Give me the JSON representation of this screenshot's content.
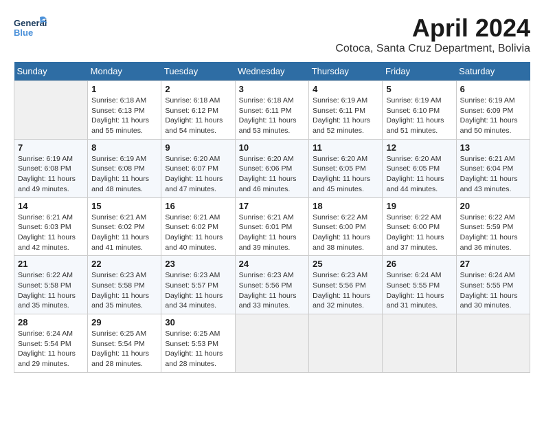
{
  "header": {
    "logo_general": "General",
    "logo_blue": "Blue",
    "month": "April 2024",
    "location": "Cotoca, Santa Cruz Department, Bolivia"
  },
  "days_of_week": [
    "Sunday",
    "Monday",
    "Tuesday",
    "Wednesday",
    "Thursday",
    "Friday",
    "Saturday"
  ],
  "weeks": [
    [
      {
        "day": "",
        "info": ""
      },
      {
        "day": "1",
        "info": "Sunrise: 6:18 AM\nSunset: 6:13 PM\nDaylight: 11 hours\nand 55 minutes."
      },
      {
        "day": "2",
        "info": "Sunrise: 6:18 AM\nSunset: 6:12 PM\nDaylight: 11 hours\nand 54 minutes."
      },
      {
        "day": "3",
        "info": "Sunrise: 6:18 AM\nSunset: 6:11 PM\nDaylight: 11 hours\nand 53 minutes."
      },
      {
        "day": "4",
        "info": "Sunrise: 6:19 AM\nSunset: 6:11 PM\nDaylight: 11 hours\nand 52 minutes."
      },
      {
        "day": "5",
        "info": "Sunrise: 6:19 AM\nSunset: 6:10 PM\nDaylight: 11 hours\nand 51 minutes."
      },
      {
        "day": "6",
        "info": "Sunrise: 6:19 AM\nSunset: 6:09 PM\nDaylight: 11 hours\nand 50 minutes."
      }
    ],
    [
      {
        "day": "7",
        "info": "Sunrise: 6:19 AM\nSunset: 6:08 PM\nDaylight: 11 hours\nand 49 minutes."
      },
      {
        "day": "8",
        "info": "Sunrise: 6:19 AM\nSunset: 6:08 PM\nDaylight: 11 hours\nand 48 minutes."
      },
      {
        "day": "9",
        "info": "Sunrise: 6:20 AM\nSunset: 6:07 PM\nDaylight: 11 hours\nand 47 minutes."
      },
      {
        "day": "10",
        "info": "Sunrise: 6:20 AM\nSunset: 6:06 PM\nDaylight: 11 hours\nand 46 minutes."
      },
      {
        "day": "11",
        "info": "Sunrise: 6:20 AM\nSunset: 6:05 PM\nDaylight: 11 hours\nand 45 minutes."
      },
      {
        "day": "12",
        "info": "Sunrise: 6:20 AM\nSunset: 6:05 PM\nDaylight: 11 hours\nand 44 minutes."
      },
      {
        "day": "13",
        "info": "Sunrise: 6:21 AM\nSunset: 6:04 PM\nDaylight: 11 hours\nand 43 minutes."
      }
    ],
    [
      {
        "day": "14",
        "info": "Sunrise: 6:21 AM\nSunset: 6:03 PM\nDaylight: 11 hours\nand 42 minutes."
      },
      {
        "day": "15",
        "info": "Sunrise: 6:21 AM\nSunset: 6:02 PM\nDaylight: 11 hours\nand 41 minutes."
      },
      {
        "day": "16",
        "info": "Sunrise: 6:21 AM\nSunset: 6:02 PM\nDaylight: 11 hours\nand 40 minutes."
      },
      {
        "day": "17",
        "info": "Sunrise: 6:21 AM\nSunset: 6:01 PM\nDaylight: 11 hours\nand 39 minutes."
      },
      {
        "day": "18",
        "info": "Sunrise: 6:22 AM\nSunset: 6:00 PM\nDaylight: 11 hours\nand 38 minutes."
      },
      {
        "day": "19",
        "info": "Sunrise: 6:22 AM\nSunset: 6:00 PM\nDaylight: 11 hours\nand 37 minutes."
      },
      {
        "day": "20",
        "info": "Sunrise: 6:22 AM\nSunset: 5:59 PM\nDaylight: 11 hours\nand 36 minutes."
      }
    ],
    [
      {
        "day": "21",
        "info": "Sunrise: 6:22 AM\nSunset: 5:58 PM\nDaylight: 11 hours\nand 35 minutes."
      },
      {
        "day": "22",
        "info": "Sunrise: 6:23 AM\nSunset: 5:58 PM\nDaylight: 11 hours\nand 35 minutes."
      },
      {
        "day": "23",
        "info": "Sunrise: 6:23 AM\nSunset: 5:57 PM\nDaylight: 11 hours\nand 34 minutes."
      },
      {
        "day": "24",
        "info": "Sunrise: 6:23 AM\nSunset: 5:56 PM\nDaylight: 11 hours\nand 33 minutes."
      },
      {
        "day": "25",
        "info": "Sunrise: 6:23 AM\nSunset: 5:56 PM\nDaylight: 11 hours\nand 32 minutes."
      },
      {
        "day": "26",
        "info": "Sunrise: 6:24 AM\nSunset: 5:55 PM\nDaylight: 11 hours\nand 31 minutes."
      },
      {
        "day": "27",
        "info": "Sunrise: 6:24 AM\nSunset: 5:55 PM\nDaylight: 11 hours\nand 30 minutes."
      }
    ],
    [
      {
        "day": "28",
        "info": "Sunrise: 6:24 AM\nSunset: 5:54 PM\nDaylight: 11 hours\nand 29 minutes."
      },
      {
        "day": "29",
        "info": "Sunrise: 6:25 AM\nSunset: 5:54 PM\nDaylight: 11 hours\nand 28 minutes."
      },
      {
        "day": "30",
        "info": "Sunrise: 6:25 AM\nSunset: 5:53 PM\nDaylight: 11 hours\nand 28 minutes."
      },
      {
        "day": "",
        "info": ""
      },
      {
        "day": "",
        "info": ""
      },
      {
        "day": "",
        "info": ""
      },
      {
        "day": "",
        "info": ""
      }
    ]
  ]
}
